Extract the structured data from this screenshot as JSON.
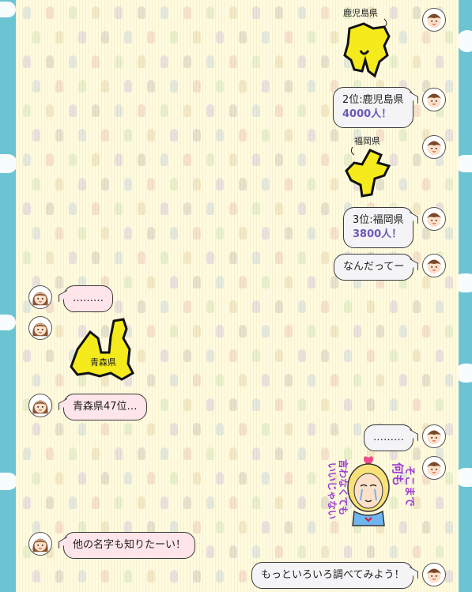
{
  "conversation": {
    "messages": [
      {
        "label": "鹿児島県"
      },
      {
        "rank": "2位:鹿児島県",
        "count": "4000人！"
      },
      {
        "label": "福岡県"
      },
      {
        "rank": "3位:福岡県",
        "count": "3800人！"
      },
      {
        "text": "なんだってー"
      },
      {
        "text": "………"
      },
      {
        "label": "青森県"
      },
      {
        "text": "青森県47位…"
      },
      {
        "text": "………"
      },
      {
        "text": "他の名字も知りたーい！"
      },
      {
        "text": "もっといろいろ調べてみよう！"
      }
    ],
    "sticker_text": [
      "何も",
      "そこまで",
      "言わなくても",
      "いいじゃない"
    ]
  },
  "colors": {
    "frame": "#6cc4d3",
    "background": "#fffbe0",
    "map_fill": "#f5ea1c",
    "accent_text": "#6e58b8",
    "bubble_pink": "#fde5ea",
    "bubble_gray": "#f4f4f6"
  },
  "icons": {
    "boy_avatar": "boy-avatar",
    "girl_avatar": "girl-avatar",
    "map_stickers": [
      "kagoshima-map",
      "fukuoka-map",
      "aomori-map"
    ],
    "character_sticker": "crying-girl-sticker"
  }
}
